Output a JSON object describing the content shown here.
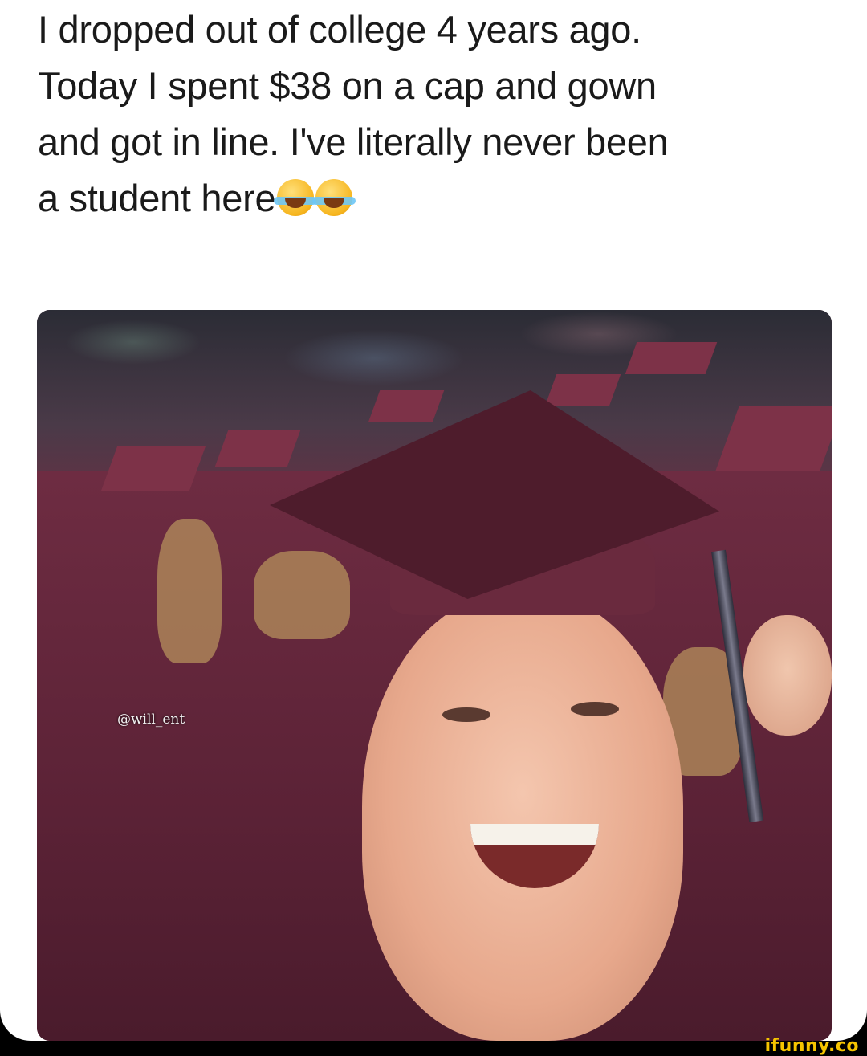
{
  "caption": {
    "line1": "I dropped out of college 4 years ago.",
    "line2": "Today I spent $38 on a cap and gown",
    "line3": "and got in line. I've literally never been",
    "line4": "a student here",
    "emojis": [
      "face-with-tears-of-joy-icon",
      "face-with-tears-of-joy-icon"
    ]
  },
  "photo": {
    "watermark": "@will_ent"
  },
  "branding": {
    "logo": "ifunny.co"
  },
  "colors": {
    "gown": "#5b2236",
    "logo": "#f5c400"
  }
}
